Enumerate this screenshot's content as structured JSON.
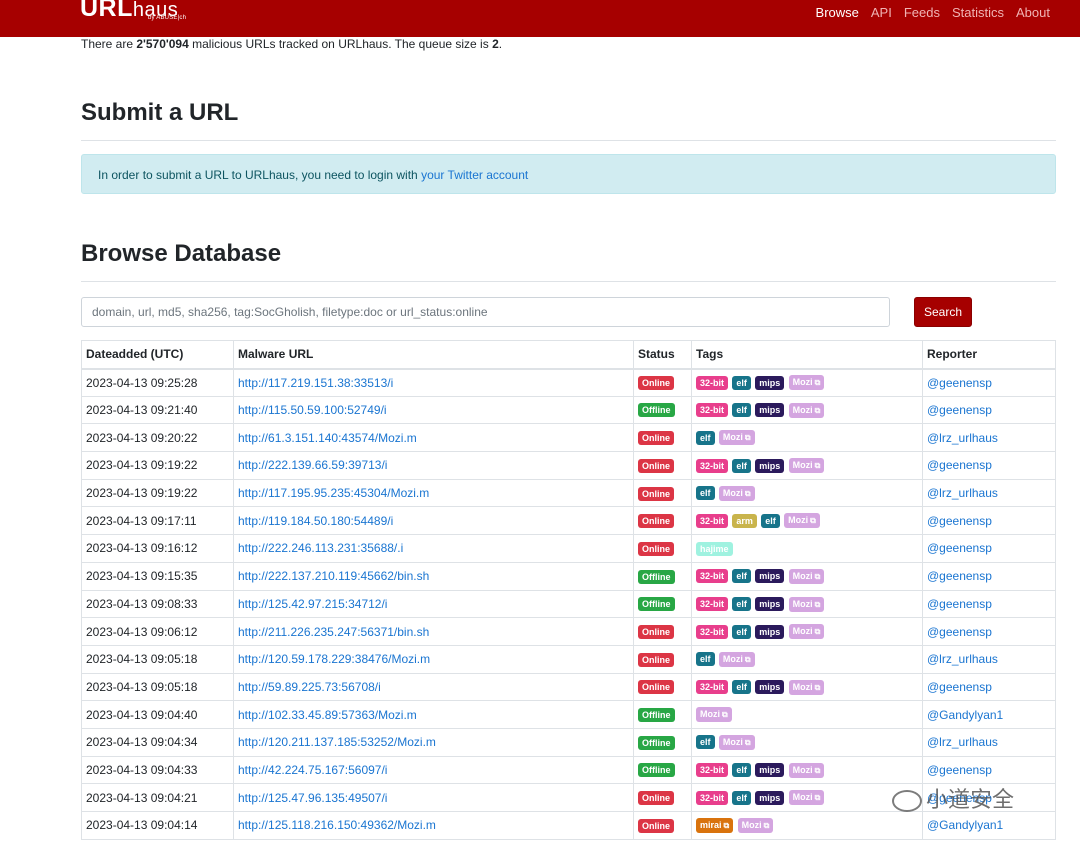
{
  "navbar": {
    "logo_main": "URL",
    "logo_haus": "haus",
    "logo_sub": "by ABUSE|ch",
    "links": [
      {
        "label": "Browse",
        "active": true
      },
      {
        "label": "API",
        "active": false
      },
      {
        "label": "Feeds",
        "active": false
      },
      {
        "label": "Statistics",
        "active": false
      },
      {
        "label": "About",
        "active": false
      }
    ]
  },
  "stats": {
    "prefix": "There are ",
    "count": "2'570'094",
    "middle": " malicious URLs tracked on URLhaus. The queue size is ",
    "queue": "2",
    "suffix": "."
  },
  "submit": {
    "title": "Submit a URL",
    "alert_text": "In order to submit a URL to URLhaus, you need to login with ",
    "alert_link": "your Twitter account"
  },
  "browse": {
    "title": "Browse Database",
    "search_placeholder": "domain, url, md5, sha256, tag:SocGholish, filetype:doc or url_status:online",
    "search_button": "Search",
    "columns": [
      "Dateadded (UTC)",
      "Malware URL",
      "Status",
      "Tags",
      "Reporter"
    ],
    "rows": [
      {
        "date": "2023-04-13 09:25:28",
        "url": "http://117.219.151.38:33513/i",
        "status": "Online",
        "tags": [
          "32-bit",
          "elf",
          "mips",
          "Mozi"
        ],
        "reporter": "@geenensp"
      },
      {
        "date": "2023-04-13 09:21:40",
        "url": "http://115.50.59.100:52749/i",
        "status": "Offline",
        "tags": [
          "32-bit",
          "elf",
          "mips",
          "Mozi"
        ],
        "reporter": "@geenensp"
      },
      {
        "date": "2023-04-13 09:20:22",
        "url": "http://61.3.151.140:43574/Mozi.m",
        "status": "Online",
        "tags": [
          "elf",
          "Mozi"
        ],
        "reporter": "@lrz_urlhaus"
      },
      {
        "date": "2023-04-13 09:19:22",
        "url": "http://222.139.66.59:39713/i",
        "status": "Online",
        "tags": [
          "32-bit",
          "elf",
          "mips",
          "Mozi"
        ],
        "reporter": "@geenensp"
      },
      {
        "date": "2023-04-13 09:19:22",
        "url": "http://117.195.95.235:45304/Mozi.m",
        "status": "Online",
        "tags": [
          "elf",
          "Mozi"
        ],
        "reporter": "@lrz_urlhaus"
      },
      {
        "date": "2023-04-13 09:17:11",
        "url": "http://119.184.50.180:54489/i",
        "status": "Online",
        "tags": [
          "32-bit",
          "arm",
          "elf",
          "Mozi"
        ],
        "reporter": "@geenensp"
      },
      {
        "date": "2023-04-13 09:16:12",
        "url": "http://222.246.113.231:35688/.i",
        "status": "Online",
        "tags": [
          "hajime"
        ],
        "reporter": "@geenensp"
      },
      {
        "date": "2023-04-13 09:15:35",
        "url": "http://222.137.210.119:45662/bin.sh",
        "status": "Offline",
        "tags": [
          "32-bit",
          "elf",
          "mips",
          "Mozi"
        ],
        "reporter": "@geenensp"
      },
      {
        "date": "2023-04-13 09:08:33",
        "url": "http://125.42.97.215:34712/i",
        "status": "Offline",
        "tags": [
          "32-bit",
          "elf",
          "mips",
          "Mozi"
        ],
        "reporter": "@geenensp"
      },
      {
        "date": "2023-04-13 09:06:12",
        "url": "http://211.226.235.247:56371/bin.sh",
        "status": "Online",
        "tags": [
          "32-bit",
          "elf",
          "mips",
          "Mozi"
        ],
        "reporter": "@geenensp"
      },
      {
        "date": "2023-04-13 09:05:18",
        "url": "http://120.59.178.229:38476/Mozi.m",
        "status": "Online",
        "tags": [
          "elf",
          "Mozi"
        ],
        "reporter": "@lrz_urlhaus"
      },
      {
        "date": "2023-04-13 09:05:18",
        "url": "http://59.89.225.73:56708/i",
        "status": "Online",
        "tags": [
          "32-bit",
          "elf",
          "mips",
          "Mozi"
        ],
        "reporter": "@geenensp"
      },
      {
        "date": "2023-04-13 09:04:40",
        "url": "http://102.33.45.89:57363/Mozi.m",
        "status": "Offline",
        "tags": [
          "Mozi"
        ],
        "reporter": "@Gandylyan1"
      },
      {
        "date": "2023-04-13 09:04:34",
        "url": "http://120.211.137.185:53252/Mozi.m",
        "status": "Offline",
        "tags": [
          "elf",
          "Mozi"
        ],
        "reporter": "@lrz_urlhaus"
      },
      {
        "date": "2023-04-13 09:04:33",
        "url": "http://42.224.75.167:56097/i",
        "status": "Offline",
        "tags": [
          "32-bit",
          "elf",
          "mips",
          "Mozi"
        ],
        "reporter": "@geenensp"
      },
      {
        "date": "2023-04-13 09:04:21",
        "url": "http://125.47.96.135:49507/i",
        "status": "Online",
        "tags": [
          "32-bit",
          "elf",
          "mips",
          "Mozi"
        ],
        "reporter": "@geenensp"
      },
      {
        "date": "2023-04-13 09:04:14",
        "url": "http://125.118.216.150:49362/Mozi.m",
        "status": "Online",
        "tags": [
          "mirai",
          "Mozi"
        ],
        "reporter": "@Gandylyan1"
      }
    ]
  },
  "tag_colors": {
    "32-bit": "#e83e8c",
    "elf": "#17748a",
    "mips": "#2b1a5c",
    "Mozi": "#d4a5e0",
    "arm": "#c9b44c",
    "hajime": "#9ff2e0",
    "mirai": "#d9730d"
  },
  "external_tags": [
    "Mozi",
    "mirai"
  ],
  "watermark": "小道安全",
  "colors": {
    "brand": "#a60000",
    "link": "#1a75d1",
    "online": "#dc3545",
    "offline": "#28a745"
  }
}
